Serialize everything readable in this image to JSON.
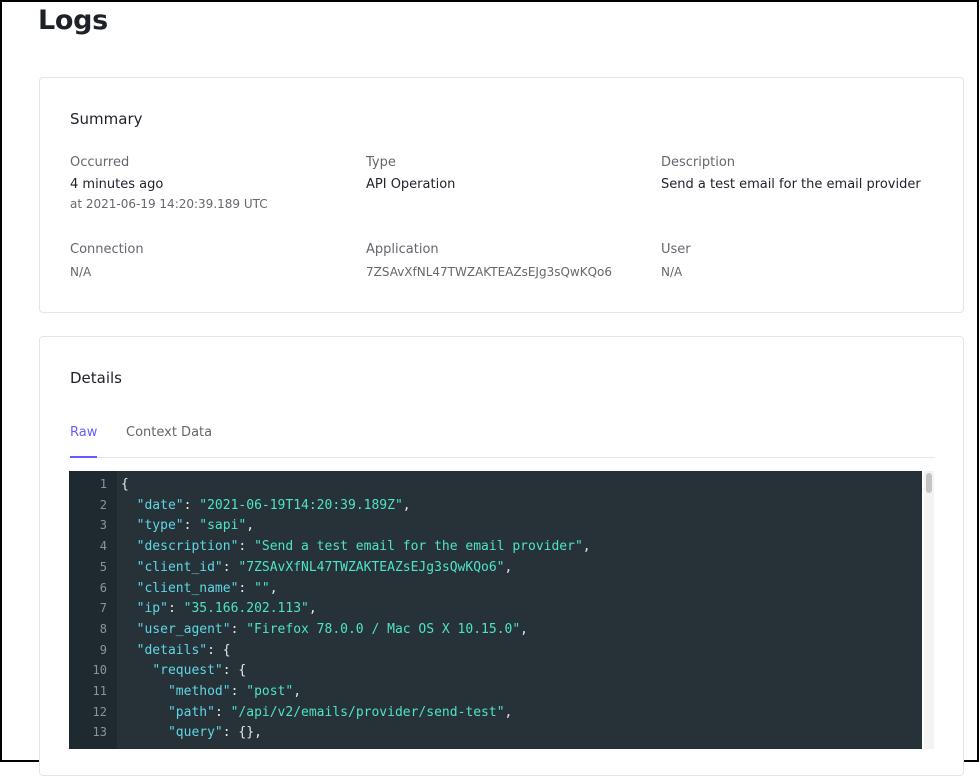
{
  "page": {
    "title": "Logs"
  },
  "summary": {
    "title": "Summary",
    "occurred": {
      "label": "Occurred",
      "value": "4 minutes ago",
      "sub": "at 2021-06-19 14:20:39.189 UTC"
    },
    "type": {
      "label": "Type",
      "value": "API Operation"
    },
    "description": {
      "label": "Description",
      "value": "Send a test email for the email provider"
    },
    "connection": {
      "label": "Connection",
      "value": "N/A"
    },
    "application": {
      "label": "Application",
      "value": "7ZSAvXfNL47TWZAKTEAZsEJg3sQwKQo6"
    },
    "user": {
      "label": "User",
      "value": "N/A"
    }
  },
  "details": {
    "title": "Details",
    "tabs": [
      {
        "label": "Raw",
        "active": true
      },
      {
        "label": "Context Data",
        "active": false
      }
    ],
    "code_lines": [
      {
        "n": "1",
        "tokens": [
          {
            "t": "p",
            "v": "{"
          }
        ]
      },
      {
        "n": "2",
        "tokens": [
          {
            "t": "p",
            "v": "  "
          },
          {
            "t": "k",
            "v": "\"date\""
          },
          {
            "t": "p",
            "v": ": "
          },
          {
            "t": "s",
            "v": "\"2021-06-19T14:20:39.189Z\""
          },
          {
            "t": "p",
            "v": ","
          }
        ]
      },
      {
        "n": "3",
        "tokens": [
          {
            "t": "p",
            "v": "  "
          },
          {
            "t": "k",
            "v": "\"type\""
          },
          {
            "t": "p",
            "v": ": "
          },
          {
            "t": "s",
            "v": "\"sapi\""
          },
          {
            "t": "p",
            "v": ","
          }
        ]
      },
      {
        "n": "4",
        "tokens": [
          {
            "t": "p",
            "v": "  "
          },
          {
            "t": "k",
            "v": "\"description\""
          },
          {
            "t": "p",
            "v": ": "
          },
          {
            "t": "s",
            "v": "\"Send a test email for the email provider\""
          },
          {
            "t": "p",
            "v": ","
          }
        ]
      },
      {
        "n": "5",
        "tokens": [
          {
            "t": "p",
            "v": "  "
          },
          {
            "t": "k",
            "v": "\"client_id\""
          },
          {
            "t": "p",
            "v": ": "
          },
          {
            "t": "s",
            "v": "\"7ZSAvXfNL47TWZAKTEAZsEJg3sQwKQo6\""
          },
          {
            "t": "p",
            "v": ","
          }
        ]
      },
      {
        "n": "6",
        "tokens": [
          {
            "t": "p",
            "v": "  "
          },
          {
            "t": "k",
            "v": "\"client_name\""
          },
          {
            "t": "p",
            "v": ": "
          },
          {
            "t": "s",
            "v": "\"\""
          },
          {
            "t": "p",
            "v": ","
          }
        ]
      },
      {
        "n": "7",
        "tokens": [
          {
            "t": "p",
            "v": "  "
          },
          {
            "t": "k",
            "v": "\"ip\""
          },
          {
            "t": "p",
            "v": ": "
          },
          {
            "t": "s",
            "v": "\"35.166.202.113\""
          },
          {
            "t": "p",
            "v": ","
          }
        ]
      },
      {
        "n": "8",
        "tokens": [
          {
            "t": "p",
            "v": "  "
          },
          {
            "t": "k",
            "v": "\"user_agent\""
          },
          {
            "t": "p",
            "v": ": "
          },
          {
            "t": "s",
            "v": "\"Firefox 78.0.0 / Mac OS X 10.15.0\""
          },
          {
            "t": "p",
            "v": ","
          }
        ]
      },
      {
        "n": "9",
        "tokens": [
          {
            "t": "p",
            "v": "  "
          },
          {
            "t": "k",
            "v": "\"details\""
          },
          {
            "t": "p",
            "v": ": {"
          }
        ]
      },
      {
        "n": "10",
        "tokens": [
          {
            "t": "p",
            "v": "    "
          },
          {
            "t": "k",
            "v": "\"request\""
          },
          {
            "t": "p",
            "v": ": {"
          }
        ]
      },
      {
        "n": "11",
        "tokens": [
          {
            "t": "p",
            "v": "      "
          },
          {
            "t": "k",
            "v": "\"method\""
          },
          {
            "t": "p",
            "v": ": "
          },
          {
            "t": "s",
            "v": "\"post\""
          },
          {
            "t": "p",
            "v": ","
          }
        ]
      },
      {
        "n": "12",
        "tokens": [
          {
            "t": "p",
            "v": "      "
          },
          {
            "t": "k",
            "v": "\"path\""
          },
          {
            "t": "p",
            "v": ": "
          },
          {
            "t": "s",
            "v": "\"/api/v2/emails/provider/send-test\""
          },
          {
            "t": "p",
            "v": ","
          }
        ]
      },
      {
        "n": "13",
        "tokens": [
          {
            "t": "p",
            "v": "      "
          },
          {
            "t": "k",
            "v": "\"query\""
          },
          {
            "t": "p",
            "v": ": {},"
          }
        ]
      }
    ]
  },
  "colors": {
    "accent": "#635dff",
    "code_background": "#263238",
    "code_key": "#5fd7e6",
    "code_string": "#4fe3c7"
  }
}
